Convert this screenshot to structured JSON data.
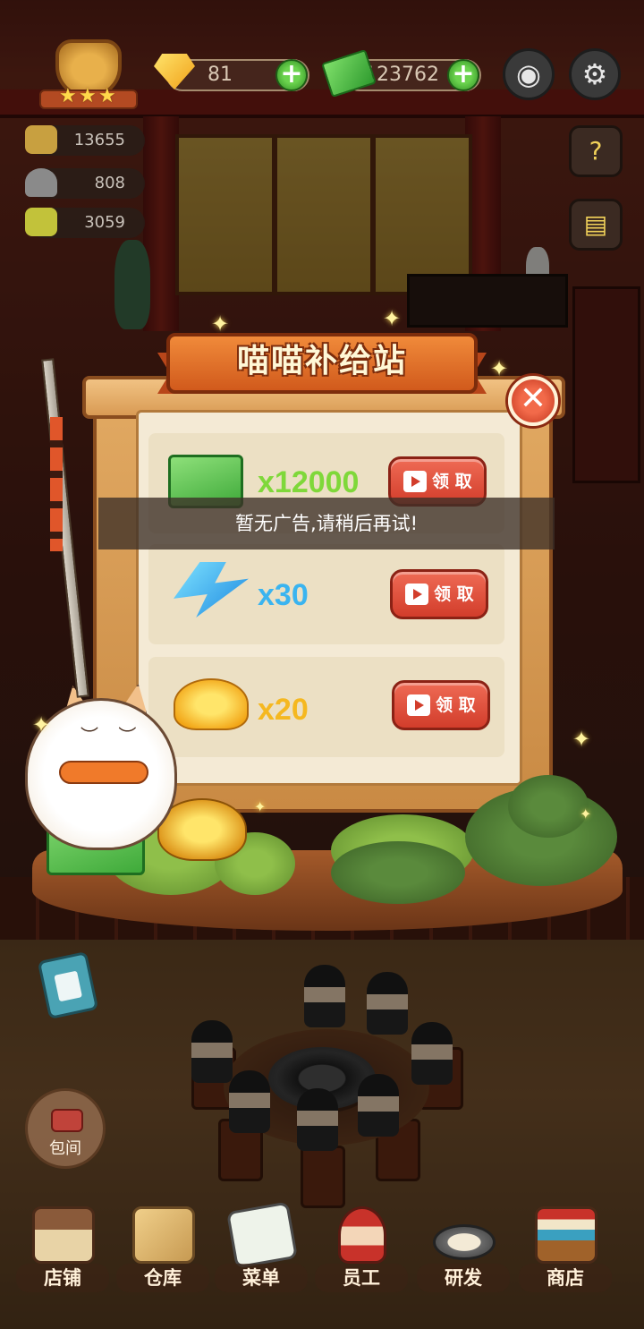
{
  "hud": {
    "gems": "81",
    "cash": "123762",
    "stats": [
      {
        "value": "13655"
      },
      {
        "value": "808"
      },
      {
        "value": "3059"
      }
    ],
    "rank_stars": 3,
    "plus_symbol": "+"
  },
  "popup": {
    "title": "喵喵补给站",
    "close_symbol": "✕",
    "toast": "暂无广告,请稍后再试!",
    "rewards": [
      {
        "item": "cash",
        "quantity": "x12000",
        "button": "领 取",
        "qty_color": "#7fd83a"
      },
      {
        "item": "energy",
        "quantity": "x30",
        "button": "领 取",
        "qty_color": "#3ab4f0"
      },
      {
        "item": "gold",
        "quantity": "x20",
        "button": "领 取",
        "qty_color": "#f5b820"
      }
    ]
  },
  "room_button": {
    "label": "包间"
  },
  "bottom_nav": [
    {
      "label": "店铺",
      "icon": "shop-building-icon"
    },
    {
      "label": "仓库",
      "icon": "warehouse-boxes-icon"
    },
    {
      "label": "菜单",
      "icon": "menu-clipboard-icon"
    },
    {
      "label": "员工",
      "icon": "staff-chef-icon"
    },
    {
      "label": "研发",
      "icon": "research-wok-icon"
    },
    {
      "label": "商店",
      "icon": "store-stall-icon"
    }
  ],
  "colors": {
    "popup_frame": "#d99b54",
    "popup_paper": "#f4ead5",
    "claim_button": "#d23d2b",
    "banner": "#e0702a"
  }
}
